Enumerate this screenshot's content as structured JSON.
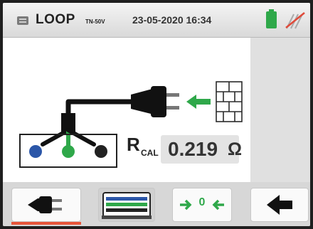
{
  "header": {
    "title": "LOOP",
    "title_sub": "TN-50V",
    "datetime": "23-05-2020 16:34"
  },
  "icons": {
    "menu": "menu-icon",
    "battery": "battery-icon",
    "remote": "remote-disabled-icon"
  },
  "measurement": {
    "label": "R",
    "label_sub": "CAL",
    "value": "0.219",
    "unit": "Ω"
  },
  "toolbar": {
    "zero_label": "0"
  },
  "colors": {
    "accent_green": "#2fa84a",
    "probe_blue": "#2b56a8",
    "selection_underline": "#e8553a",
    "wall": "#ffffff"
  }
}
